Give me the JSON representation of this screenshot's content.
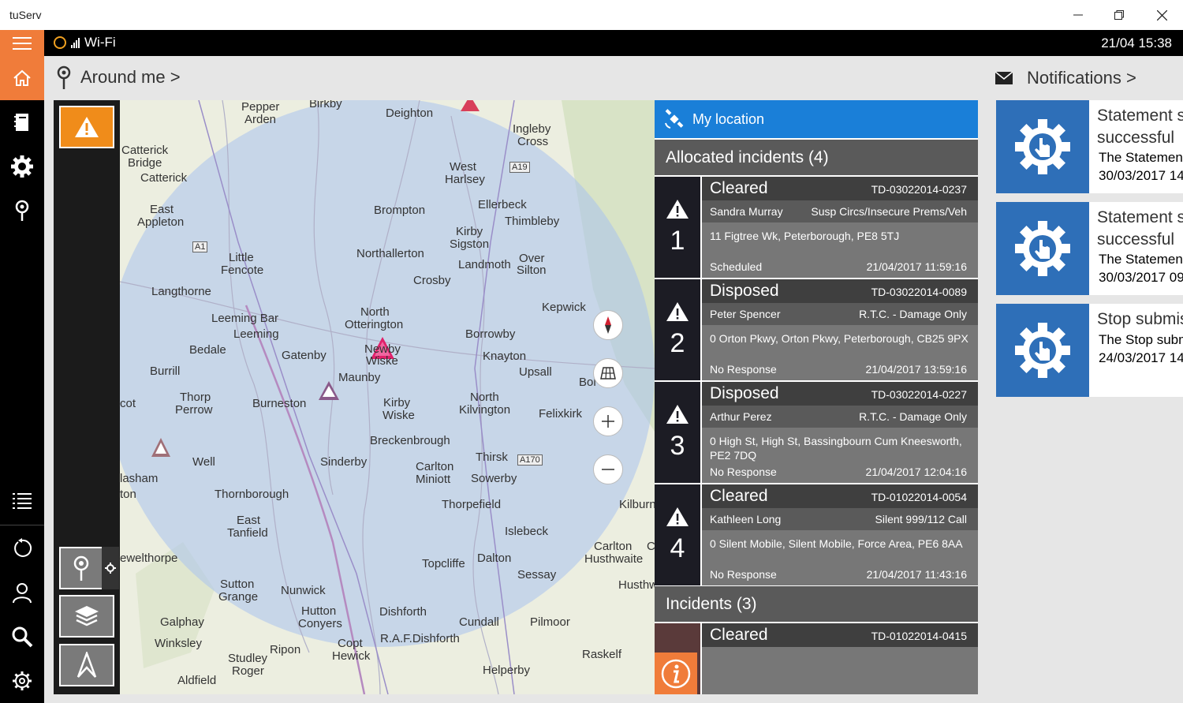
{
  "window": {
    "title": "tuServ"
  },
  "status_bar": {
    "network": "Wi-Fi",
    "datetime": "21/04 15:38"
  },
  "header": {
    "around_me": "Around me >",
    "notifications": "Notifications >"
  },
  "panel": {
    "my_location": "My location",
    "allocated_header": "Allocated incidents (4)",
    "incidents_header": "Incidents (3)",
    "allocated": [
      {
        "number": "1",
        "status": "Cleared",
        "id": "TD-03022014-0237",
        "person": "Sandra Murray",
        "type": "Susp Circs/Insecure Prems/Veh",
        "address": "11 Figtree Wk, Peterborough, PE8 5TJ",
        "response": "Scheduled",
        "time": "21/04/2017 11:59:16"
      },
      {
        "number": "2",
        "status": "Disposed",
        "id": "TD-03022014-0089",
        "person": "Peter Spencer",
        "type": "R.T.C. - Damage Only",
        "address": "0 Orton Pkwy, Orton Pkwy, Peterborough, CB25 9PX",
        "response": "No Response",
        "time": "21/04/2017 13:59:16"
      },
      {
        "number": "3",
        "status": "Disposed",
        "id": "TD-03022014-0227",
        "person": "Arthur Perez",
        "type": "R.T.C. - Damage Only",
        "address": "0 High St, High St, Bassingbourn Cum Kneesworth, PE2 7DQ",
        "response": "No Response",
        "time": "21/04/2017 12:04:16"
      },
      {
        "number": "4",
        "status": "Cleared",
        "id": "TD-01022014-0054",
        "person": "Kathleen Long",
        "type": "Silent 999/112 Call",
        "address": "0 Silent Mobile, Silent Mobile, Force Area, PE6 8AA",
        "response": "No Response",
        "time": "21/04/2017 11:43:16"
      }
    ],
    "incident_partial": {
      "status": "Cleared",
      "id": "TD-01022014-0415"
    }
  },
  "notifications": [
    {
      "line1": "Statement su",
      "line1b": "successful",
      "line2": "The Statemen",
      "line3": "30/03/2017 14"
    },
    {
      "line1": "Statement su",
      "line1b": "successful",
      "line2": "The Statemen",
      "line3": "30/03/2017 09"
    },
    {
      "line1": "Stop submis",
      "line1b": "",
      "line2": "The Stop subm",
      "line3": "24/03/2017 14"
    }
  ],
  "map": {
    "labels": [
      {
        "text": "Pepper"
      },
      {
        "text": "Arden"
      },
      {
        "text": "Birkby"
      },
      {
        "text": "Deighton"
      },
      {
        "text": "Ingleby"
      },
      {
        "text": "Cross"
      },
      {
        "text": "Catterick"
      },
      {
        "text": "Bridge"
      },
      {
        "text": "Catterick"
      },
      {
        "text": "West"
      },
      {
        "text": "Harlsey"
      },
      {
        "text": "A19"
      },
      {
        "text": "East"
      },
      {
        "text": "Appleton"
      },
      {
        "text": "Brompton"
      },
      {
        "text": "Ellerbeck"
      },
      {
        "text": "Thimbleby"
      },
      {
        "text": "A1"
      },
      {
        "text": "Kirby"
      },
      {
        "text": "Sigston"
      },
      {
        "text": "Little"
      },
      {
        "text": "Fencote"
      },
      {
        "text": "Northallerton"
      },
      {
        "text": "Landmoth"
      },
      {
        "text": "Over"
      },
      {
        "text": "Silton"
      },
      {
        "text": "Crosby"
      },
      {
        "text": "Langthorne"
      },
      {
        "text": "North"
      },
      {
        "text": "Otterington"
      },
      {
        "text": "Kepwick"
      },
      {
        "text": "Leeming Bar"
      },
      {
        "text": "Leeming"
      },
      {
        "text": "Borrowby"
      },
      {
        "text": "Bedale"
      },
      {
        "text": "Gatenby"
      },
      {
        "text": "Newby"
      },
      {
        "text": "Wiske"
      },
      {
        "text": "Knayton"
      },
      {
        "text": "Burrill"
      },
      {
        "text": "Maunby"
      },
      {
        "text": "Upsall"
      },
      {
        "text": "Bol"
      },
      {
        "text": "Thorp"
      },
      {
        "text": "Perrow"
      },
      {
        "text": "Burneston"
      },
      {
        "text": "Kirby"
      },
      {
        "text": "Wiske"
      },
      {
        "text": "North"
      },
      {
        "text": "Kilvington"
      },
      {
        "text": "Felixkirk"
      },
      {
        "text": "cot"
      },
      {
        "text": "Breckenbrough"
      },
      {
        "text": "Thirsk"
      },
      {
        "text": "A170"
      },
      {
        "text": "Well"
      },
      {
        "text": "Sinderby"
      },
      {
        "text": "Carlton"
      },
      {
        "text": "Miniott"
      },
      {
        "text": "Sowerby"
      },
      {
        "text": "lasham"
      },
      {
        "text": "Kilburn"
      },
      {
        "text": "ton"
      },
      {
        "text": "Thornborough"
      },
      {
        "text": "Thorpefield"
      },
      {
        "text": "East"
      },
      {
        "text": "Tanfield"
      },
      {
        "text": "Islebeck"
      },
      {
        "text": "Carlton"
      },
      {
        "text": "C"
      },
      {
        "text": "Husthwaite"
      },
      {
        "text": "ewelthorpe"
      },
      {
        "text": "Topcliffe"
      },
      {
        "text": "Dalton"
      },
      {
        "text": "Sessay"
      },
      {
        "text": "Sutton"
      },
      {
        "text": "Grange"
      },
      {
        "text": "Nunwick"
      },
      {
        "text": "Husthw"
      },
      {
        "text": "Hutton"
      },
      {
        "text": "Conyers"
      },
      {
        "text": "Dishforth"
      },
      {
        "text": "Galphay"
      },
      {
        "text": "Cundall"
      },
      {
        "text": "Pilmoor"
      },
      {
        "text": "Winksley"
      },
      {
        "text": "R.A.F.Dishforth"
      },
      {
        "text": "Copt"
      },
      {
        "text": "Hewick"
      },
      {
        "text": "Ripon"
      },
      {
        "text": "Raskelf"
      },
      {
        "text": "Studley"
      },
      {
        "text": "Roger"
      },
      {
        "text": "Aldfield"
      },
      {
        "text": "Helperby"
      }
    ]
  }
}
